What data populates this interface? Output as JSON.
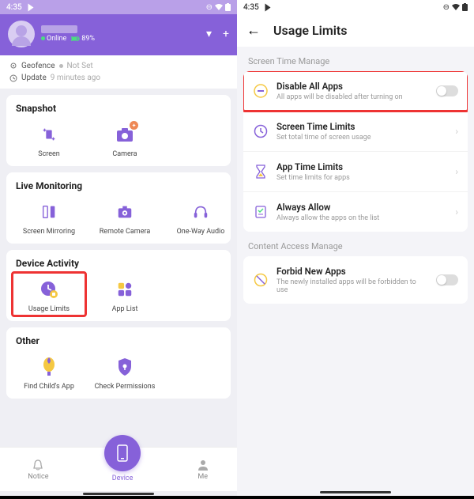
{
  "colors": {
    "accent": "#8661d9",
    "highlight": "#e33"
  },
  "left": {
    "statusbar": {
      "time": "4:35"
    },
    "user": {
      "status_label": "Online",
      "battery_label": "89%"
    },
    "info": {
      "geofence_label": "Geofence",
      "geofence_value": "Not Set",
      "update_label": "Update",
      "update_value": "9 minutes ago"
    },
    "sections": {
      "snapshot": {
        "title": "Snapshot",
        "items": [
          {
            "label": "Screen",
            "icon": "screen-icon"
          },
          {
            "label": "Camera",
            "icon": "camera-icon"
          }
        ]
      },
      "live": {
        "title": "Live Monitoring",
        "items": [
          {
            "label": "Screen Mirroring",
            "icon": "mirror-icon"
          },
          {
            "label": "Remote Camera",
            "icon": "remote-camera-icon"
          },
          {
            "label": "One-Way Audio",
            "icon": "headphones-icon"
          }
        ]
      },
      "activity": {
        "title": "Device Activity",
        "items": [
          {
            "label": "Usage Limits",
            "icon": "usage-limits-icon"
          },
          {
            "label": "App List",
            "icon": "app-list-icon"
          }
        ]
      },
      "other": {
        "title": "Other",
        "items": [
          {
            "label": "Find Child's App",
            "icon": "find-app-icon"
          },
          {
            "label": "Check Permissions",
            "icon": "shield-icon"
          }
        ]
      }
    },
    "tabbar": {
      "notice": "Notice",
      "device": "Device",
      "me": "Me"
    }
  },
  "right": {
    "statusbar": {
      "time": "4:35"
    },
    "title": "Usage Limits",
    "screen_time_section": "Screen Time Manage",
    "rows": {
      "disable": {
        "title": "Disable All Apps",
        "sub": "All apps will be disabled after turning on"
      },
      "screen_limits": {
        "title": "Screen Time Limits",
        "sub": "Set total time of screen usage"
      },
      "app_limits": {
        "title": "App Time Limits",
        "sub": "Set time limits for apps"
      },
      "always": {
        "title": "Always Allow",
        "sub": "Always allow the apps on the list"
      }
    },
    "content_section": "Content Access Manage",
    "forbid": {
      "title": "Forbid New Apps",
      "sub": "The newly installed apps will be forbidden to use"
    }
  }
}
